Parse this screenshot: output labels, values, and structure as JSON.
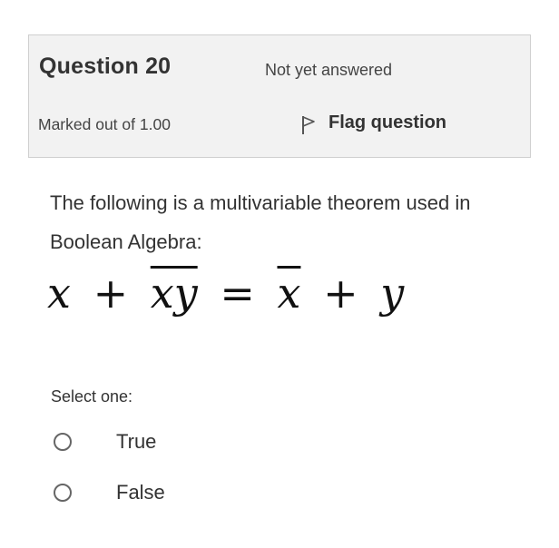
{
  "question": {
    "title": "Question 20",
    "state": "Not yet answered",
    "grade": "Marked out of 1.00",
    "flag_label": "Flag question",
    "flag_icon": "flag-icon"
  },
  "body": {
    "text": "The following is a multivariable theorem used in Boolean Algebra:",
    "formula": {
      "term1": "x",
      "plus1": "+",
      "term2": "xy",
      "equals": "=",
      "term3": "x",
      "plus2": "+",
      "term4": "y"
    }
  },
  "answer": {
    "prompt": "Select one:",
    "options": [
      {
        "label": "True",
        "selected": false
      },
      {
        "label": "False",
        "selected": false
      }
    ]
  }
}
